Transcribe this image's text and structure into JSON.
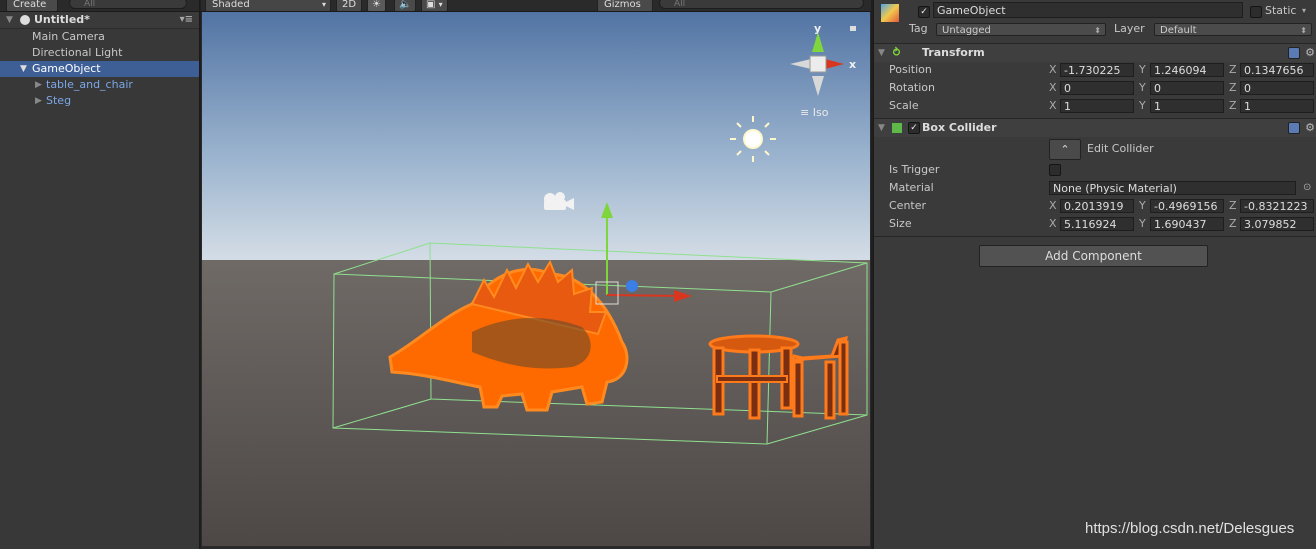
{
  "hierarchy": {
    "create_label": "Create",
    "create_arrow": "▾",
    "search_placeholder": "All",
    "scene_name": "Untitled*",
    "items": [
      {
        "label": "Main Camera"
      },
      {
        "label": "Directional Light"
      },
      {
        "label": "GameObject"
      },
      {
        "label": "table_and_chair"
      },
      {
        "label": "Steg"
      }
    ]
  },
  "scene_toolbar": {
    "draw_mode": "Shaded",
    "mode_2d": "2D",
    "gizmos_label": "Gizmos",
    "search_placeholder": "All"
  },
  "scene": {
    "gizmo_y": "y",
    "gizmo_x": "x",
    "projection": "Iso"
  },
  "inspector": {
    "object_name": "GameObject",
    "static_label": "Static",
    "tag_label": "Tag",
    "tag_value": "Untagged",
    "layer_label": "Layer",
    "layer_value": "Default",
    "transform": {
      "title": "Transform",
      "position_label": "Position",
      "rotation_label": "Rotation",
      "scale_label": "Scale",
      "position": {
        "x": "-1.730225",
        "y": "1.246094",
        "z": "0.1347656"
      },
      "rotation": {
        "x": "0",
        "y": "0",
        "z": "0"
      },
      "scale": {
        "x": "1",
        "y": "1",
        "z": "1"
      }
    },
    "box_collider": {
      "title": "Box Collider",
      "edit_collider_label": "Edit Collider",
      "is_trigger_label": "Is Trigger",
      "material_label": "Material",
      "material_value": "None (Physic Material)",
      "center_label": "Center",
      "size_label": "Size",
      "center": {
        "x": "0.2013919",
        "y": "-0.4969156",
        "z": "-0.8321223"
      },
      "size": {
        "x": "5.116924",
        "y": "1.690437",
        "z": "3.079852"
      }
    },
    "add_component_label": "Add Component",
    "axis_x": "X",
    "axis_y": "Y",
    "axis_z": "Z"
  },
  "watermark": "https://blog.csdn.net/Delesgues",
  "colors": {
    "selection": "#3e5f96",
    "prefab_text": "#7ba7e6",
    "outline_orange": "#ff6a00",
    "collider_green": "#8fe08f"
  }
}
